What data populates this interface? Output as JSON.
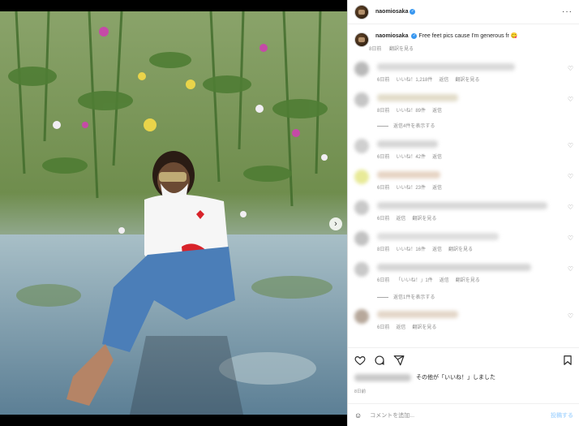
{
  "post": {
    "username": "naomiosaka",
    "caption": "Free feet pics cause I'm generous fr 😋",
    "caption_meta": [
      "8日前",
      "翻訳を見る"
    ]
  },
  "comments": [
    {
      "meta": [
        "6日前",
        "いいね！1,218件",
        "返信",
        "翻訳を見る"
      ],
      "blur_color": "#d9d9d9",
      "avatar_color": "#b9b9b9",
      "width": 170
    },
    {
      "meta": [
        "8日前",
        "いいね！89件",
        "返信"
      ],
      "blur_color": "#e2dcc9",
      "avatar_color": "#c5c5c5",
      "width": 100
    },
    {
      "meta": [
        "6日前",
        "いいね！42件",
        "返信"
      ],
      "blur_color": "#d6d6d6",
      "avatar_color": "#cfcfcf",
      "width": 75
    },
    {
      "meta": [
        "6日前",
        "いいね！23件",
        "返信"
      ],
      "blur_color": "#e6d4c4",
      "avatar_color": "#e8ea98",
      "width": 78
    },
    {
      "meta": [
        "6日前",
        "返信",
        "翻訳を見る"
      ],
      "blur_color": "#d8d8d8",
      "avatar_color": "#c9c9c9",
      "width": 210
    },
    {
      "meta": [
        "8日前",
        "いいね！16件",
        "返信",
        "翻訳を見る"
      ],
      "blur_color": "#dedede",
      "avatar_color": "#c2c2c2",
      "width": 150
    },
    {
      "meta": [
        "6日前",
        "「いいね！」1件",
        "返信",
        "翻訳を見る"
      ],
      "blur_color": "#d5d5d5",
      "avatar_color": "#c9c9c9",
      "width": 190
    },
    {
      "meta": [
        "6日前",
        "返信",
        "翻訳を見る"
      ],
      "blur_color": "#e3d6c8",
      "avatar_color": "#b7a89b",
      "width": 100
    }
  ],
  "replies": {
    "first": "返信4件を表示する",
    "second": "返信1件を表示する"
  },
  "likes_suffix": "その他が「いいね！」しました",
  "date": "8日前",
  "add_comment": {
    "placeholder": "コメントを追加...",
    "post": "投稿する"
  },
  "icons": [
    "more-icon",
    "heart-icon",
    "comment-icon",
    "share-icon",
    "save-icon",
    "emoji-icon",
    "verified-icon",
    "carousel-next-icon"
  ],
  "colors": {
    "verified": "#3897f0",
    "text": "#262626",
    "muted": "#8e8e8e",
    "post_button": "#b3dbff"
  }
}
